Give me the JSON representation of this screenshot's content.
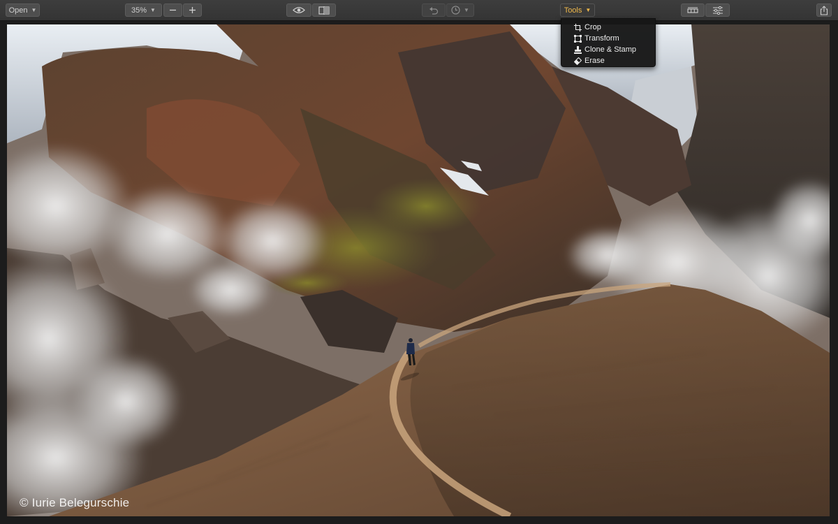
{
  "toolbar": {
    "open_label": "Open",
    "zoom_value": "35%",
    "tools_label": "Tools"
  },
  "tools_menu": {
    "items": [
      {
        "label": "Crop",
        "icon": "crop-icon"
      },
      {
        "label": "Transform",
        "icon": "transform-icon"
      },
      {
        "label": "Clone & Stamp",
        "icon": "stamp-icon"
      },
      {
        "label": "Erase",
        "icon": "eraser-icon"
      }
    ]
  },
  "image": {
    "watermark": "© Iurie Belegurschie"
  },
  "colors": {
    "accent": "#f0b84a",
    "toolbar_bg": "#3a3a3a",
    "menu_bg": "#181818"
  }
}
